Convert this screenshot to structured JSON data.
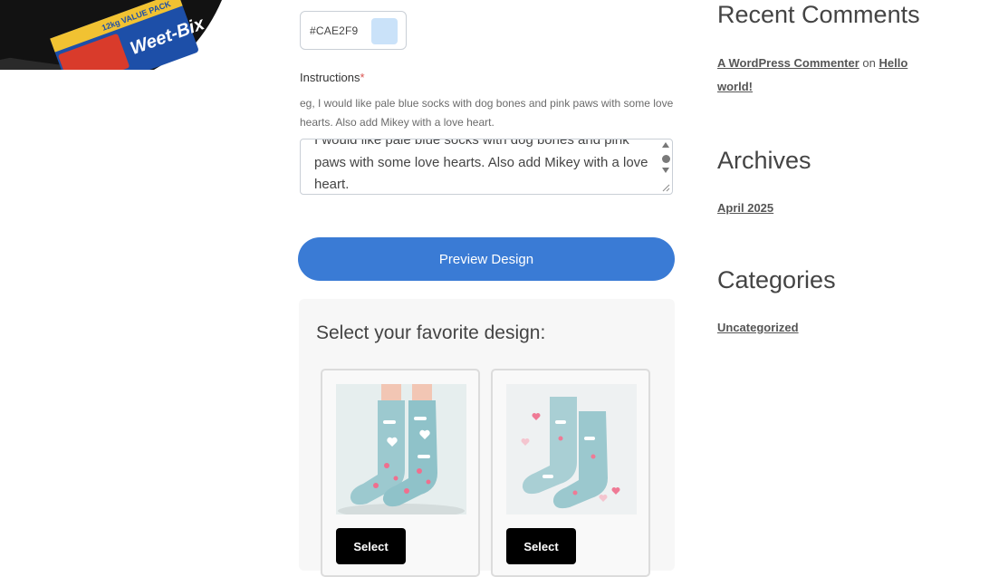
{
  "form": {
    "color_hex": "#CAE2F9",
    "color_swatch": "#CAE2F9",
    "instructions_label": "Instructions",
    "required_marker": "*",
    "instructions_hint": "eg, I would like pale blue socks with dog bones and pink paws with some love hearts. Also add Mikey with a love heart.",
    "instructions_value": "I would like pale blue socks with dog bones and pink paws with some love hearts. Also add Mikey with a love heart.",
    "preview_button": "Preview Design"
  },
  "designs": {
    "heading": "Select your favorite design:",
    "items": [
      {
        "select_label": "Select"
      },
      {
        "select_label": "Select"
      }
    ]
  },
  "sidebar": {
    "recent_comments": {
      "title": "Recent Comments",
      "author": "A WordPress Commenter",
      "connector": "on",
      "post": "Hello world!"
    },
    "archives": {
      "title": "Archives",
      "items": [
        "April 2025"
      ]
    },
    "categories": {
      "title": "Categories",
      "items": [
        "Uncategorized"
      ]
    }
  }
}
